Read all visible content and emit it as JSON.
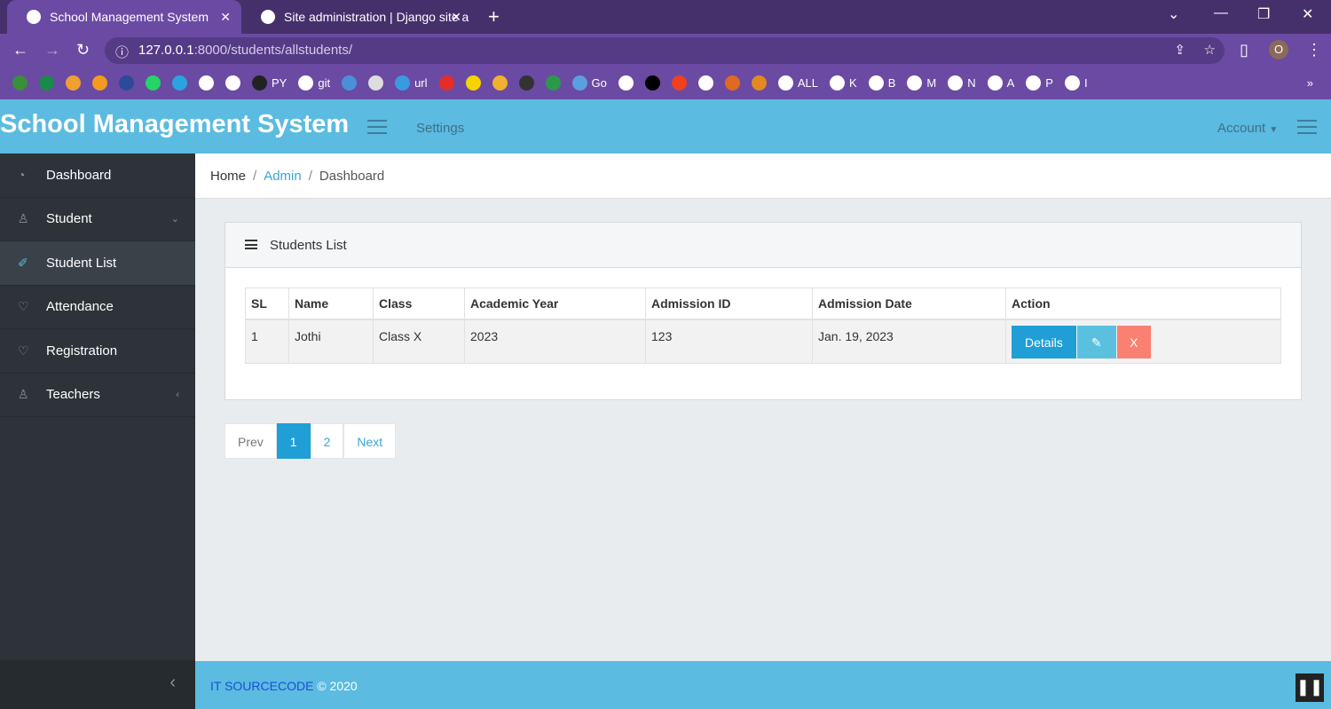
{
  "browser": {
    "tabs": [
      {
        "title": "School Management System"
      },
      {
        "title": "Site administration | Django site a"
      }
    ],
    "url_host": "127.0.0.1",
    "url_rest": ":8000/students/allstudents/",
    "profile_initial": "O",
    "bookmarks": [
      {
        "label": "",
        "color": "#3a8f3a"
      },
      {
        "label": "",
        "color": "#1a8a4a"
      },
      {
        "label": "",
        "color": "#f0a030"
      },
      {
        "label": "",
        "color": "#f29b1f"
      },
      {
        "label": "",
        "color": "#2a4a9a"
      },
      {
        "label": "",
        "color": "#25d366"
      },
      {
        "label": "",
        "color": "#2aa3e0"
      },
      {
        "label": "",
        "color": "#ffffff"
      },
      {
        "label": "",
        "color": "#ffffff"
      },
      {
        "label": "PY",
        "color": "#222"
      },
      {
        "label": "git",
        "color": "#ffffff"
      },
      {
        "label": "",
        "color": "#4a90d9"
      },
      {
        "label": "",
        "color": "#ddd"
      },
      {
        "label": "url",
        "color": "#3a9ae0"
      },
      {
        "label": "",
        "color": "#e52d27"
      },
      {
        "label": "",
        "color": "#f7d300"
      },
      {
        "label": "",
        "color": "#f0b030"
      },
      {
        "label": "",
        "color": "#333"
      },
      {
        "label": "",
        "color": "#2a9a4a"
      },
      {
        "label": "Go",
        "color": "#5aa0e0"
      },
      {
        "label": "",
        "color": "#fff"
      },
      {
        "label": "",
        "color": "#000"
      },
      {
        "label": "",
        "color": "#f04020"
      },
      {
        "label": "",
        "color": "#fff"
      },
      {
        "label": "",
        "color": "#e06a20"
      },
      {
        "label": "",
        "color": "#e08a20"
      },
      {
        "label": "ALL",
        "color": "#fff"
      },
      {
        "label": "K",
        "color": "#fff"
      },
      {
        "label": "B",
        "color": "#fff"
      },
      {
        "label": "M",
        "color": "#fff"
      },
      {
        "label": "N",
        "color": "#fff"
      },
      {
        "label": "A",
        "color": "#fff"
      },
      {
        "label": "P",
        "color": "#fff"
      },
      {
        "label": "I",
        "color": "#fff"
      }
    ]
  },
  "header": {
    "brand": "School Management System",
    "settings": "Settings",
    "account": "Account"
  },
  "sidebar": {
    "items": [
      {
        "label": "Dashboard",
        "icon": "◔"
      },
      {
        "label": "Student",
        "icon": "♙",
        "chev": "⌄"
      },
      {
        "label": "Student List",
        "icon": "✐"
      },
      {
        "label": "Attendance",
        "icon": "♡"
      },
      {
        "label": "Registration",
        "icon": "♡"
      },
      {
        "label": "Teachers",
        "icon": "♙",
        "chev": "‹"
      }
    ],
    "collapse": "‹"
  },
  "breadcrumb": {
    "home": "Home",
    "admin": "Admin",
    "current": "Dashboard"
  },
  "card": {
    "title": "Students List",
    "columns": [
      "SL",
      "Name",
      "Class",
      "Academic Year",
      "Admission ID",
      "Admission Date",
      "Action"
    ],
    "rows": [
      {
        "sl": "1",
        "name": "Jothi",
        "class": "Class X",
        "year": "2023",
        "id": "123",
        "date": "Jan. 19, 2023",
        "details": "Details",
        "edit": "✎",
        "delete": "X"
      }
    ]
  },
  "pagination": {
    "prev": "Prev",
    "pages": [
      "1",
      "2"
    ],
    "next": "Next"
  },
  "footer": {
    "brand": "IT SOURCECODE",
    "copy": " © 2020"
  },
  "colors": {
    "header": "#5bbbe0",
    "sidebar": "#2d3339",
    "primary": "#1f9fd6",
    "info": "#5bc0de",
    "danger": "#fa8072"
  }
}
